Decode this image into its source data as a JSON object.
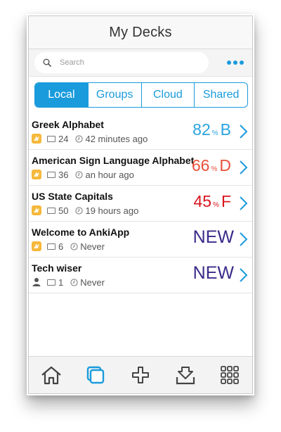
{
  "header": {
    "title": "My Decks"
  },
  "search": {
    "placeholder": "Search"
  },
  "segments": [
    "Local",
    "Groups",
    "Cloud",
    "Shared"
  ],
  "active_segment": "Local",
  "decks": [
    {
      "name": "Greek Alphabet",
      "cards": "24",
      "time": "42 minutes ago",
      "score": "82",
      "pct": "%",
      "grade": "B",
      "color": "#2aa4e0",
      "source": "app-icon"
    },
    {
      "name": "American Sign Language Alphabet",
      "cards": "36",
      "time": "an hour ago",
      "score": "66",
      "pct": "%",
      "grade": "D",
      "color": "#e8503a",
      "source": "app-icon"
    },
    {
      "name": "US State Capitals",
      "cards": "50",
      "time": "19 hours ago",
      "score": "45",
      "pct": "%",
      "grade": "F",
      "color": "#d9141e",
      "source": "app-icon"
    },
    {
      "name": "Welcome to AnkiApp",
      "cards": "6",
      "time": "Never",
      "status": "NEW",
      "source": "app-icon"
    },
    {
      "name": "Tech wiser",
      "cards": "1",
      "time": "Never",
      "status": "NEW",
      "source": "person-icon"
    }
  ],
  "colors": {
    "accent": "#1a9bdc",
    "new_text": "#3a2a8a",
    "app_icon": "#f5b83a"
  },
  "tabbar": [
    "home-icon",
    "decks-icon",
    "add-icon",
    "download-icon",
    "grid-icon"
  ]
}
